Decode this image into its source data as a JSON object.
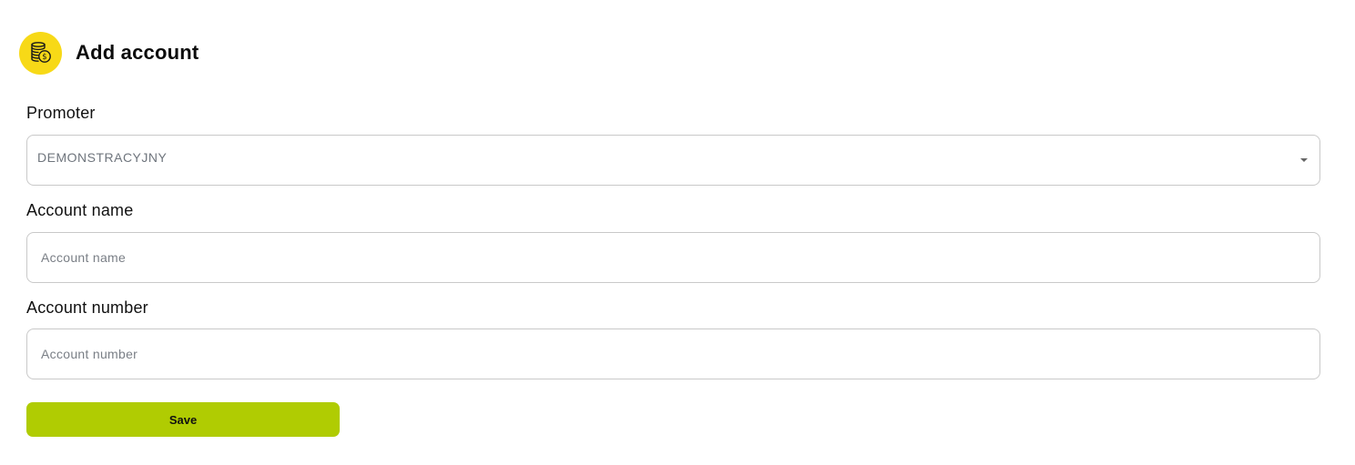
{
  "header": {
    "title": "Add account",
    "icon": "coins-icon",
    "icon_bg": "#f7d917"
  },
  "form": {
    "promoter": {
      "label": "Promoter",
      "selected_value": "DEMONSTRACYJNY"
    },
    "account_name": {
      "label": "Account name",
      "placeholder": "Account name",
      "value": ""
    },
    "account_number": {
      "label": "Account number",
      "placeholder": "Account number",
      "value": ""
    },
    "save_label": "Save",
    "save_color": "#b0cc02"
  }
}
